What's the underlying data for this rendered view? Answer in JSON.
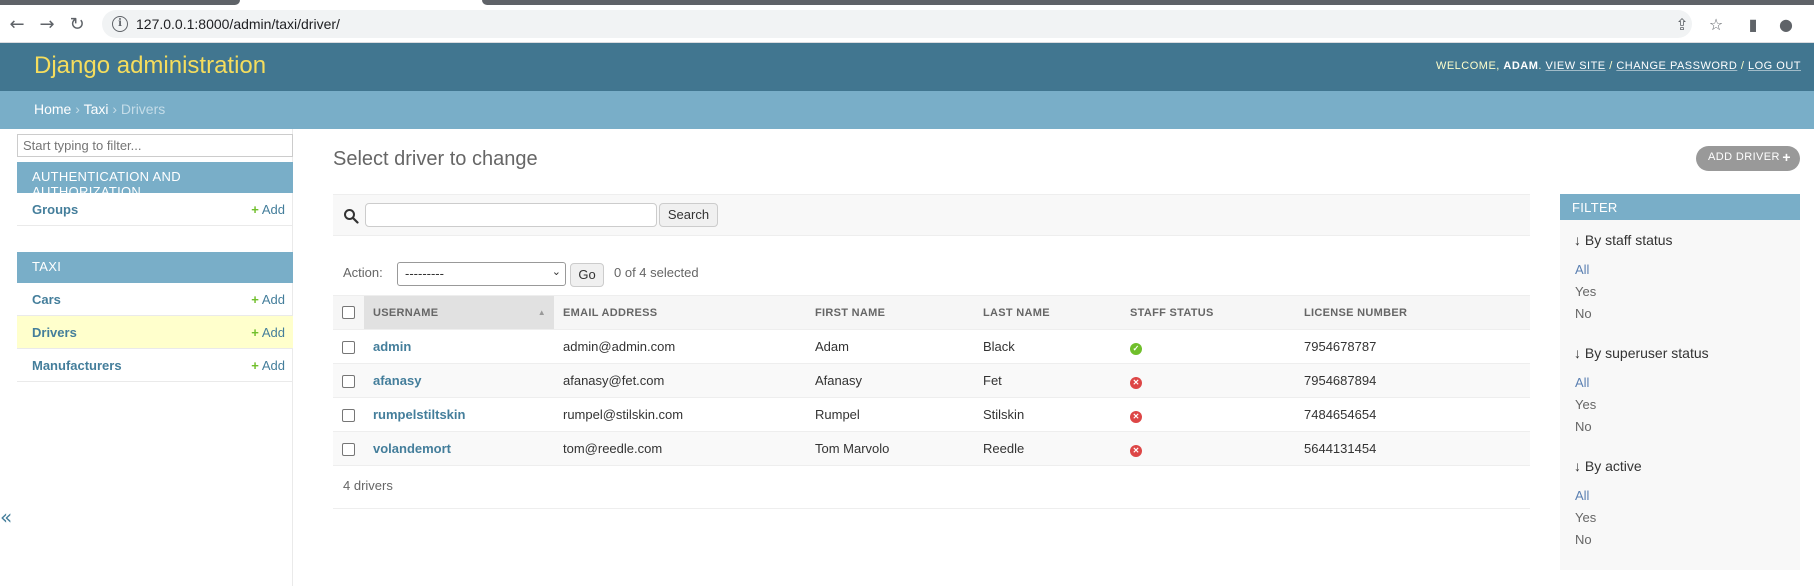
{
  "browser": {
    "url_host": "127.0.0.1",
    "url_rest": ":8000/admin/taxi/driver/"
  },
  "header": {
    "branding": "Django administration",
    "welcome": "WELCOME,",
    "user": "ADAM",
    "view_site": "VIEW SITE",
    "change_password": "CHANGE PASSWORD",
    "log_out": "LOG OUT"
  },
  "breadcrumbs": {
    "home": "Home",
    "app": "Taxi",
    "current": "Drivers"
  },
  "sidebar": {
    "filter_placeholder": "Start typing to filter...",
    "apps": [
      {
        "caption": "AUTHENTICATION AND AUTHORIZATION",
        "models": [
          {
            "name": "Groups",
            "add": "Add"
          }
        ]
      },
      {
        "caption": "TAXI",
        "models": [
          {
            "name": "Cars",
            "add": "Add"
          },
          {
            "name": "Drivers",
            "add": "Add"
          },
          {
            "name": "Manufacturers",
            "add": "Add"
          }
        ]
      }
    ],
    "collapse_label": "«"
  },
  "content": {
    "title": "Select driver to change",
    "add_button": "ADD DRIVER",
    "search_button": "Search",
    "action_label": "Action:",
    "action_selected": "---------",
    "go_button": "Go",
    "selected_count": "0 of 4 selected",
    "columns": [
      "USERNAME",
      "EMAIL ADDRESS",
      "FIRST NAME",
      "LAST NAME",
      "STAFF STATUS",
      "LICENSE NUMBER"
    ],
    "rows": [
      {
        "username": "admin",
        "email": "admin@admin.com",
        "first_name": "Adam",
        "last_name": "Black",
        "staff": true,
        "license": "7954678787"
      },
      {
        "username": "afanasy",
        "email": "afanasy@fet.com",
        "first_name": "Afanasy",
        "last_name": "Fet",
        "staff": false,
        "license": "7954687894"
      },
      {
        "username": "rumpelstiltskin",
        "email": "rumpel@stilskin.com",
        "first_name": "Rumpel",
        "last_name": "Stilskin",
        "staff": false,
        "license": "7484654654"
      },
      {
        "username": "volandemort",
        "email": "tom@reedle.com",
        "first_name": "Tom Marvolo",
        "last_name": "Reedle",
        "staff": false,
        "license": "5644131454"
      }
    ],
    "paginator": "4 drivers"
  },
  "filter": {
    "title": "FILTER",
    "groups": [
      {
        "heading": "↓ By staff status",
        "options": [
          "All",
          "Yes",
          "No"
        ]
      },
      {
        "heading": "↓ By superuser status",
        "options": [
          "All",
          "Yes",
          "No"
        ]
      },
      {
        "heading": "↓ By active",
        "options": [
          "All",
          "Yes",
          "No"
        ]
      }
    ]
  },
  "colors": {
    "header_bg": "#417690",
    "breadcrumbs_bg": "#79aec8",
    "branding": "#f5dd5d",
    "link": "#447e9b",
    "add_green": "#70bf2b",
    "no_red": "#dd4646",
    "current_model_bg": "#ffffcc"
  }
}
